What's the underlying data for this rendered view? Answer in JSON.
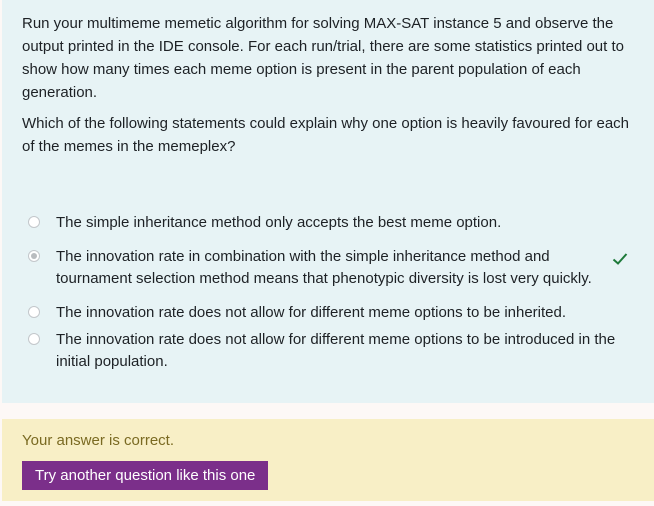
{
  "question": {
    "paragraph1": "Run your multimeme memetic algorithm for solving MAX-SAT instance 5 and observe the output printed in the IDE console. For each run/trial, there are some statistics printed out to show how many times each meme option is present in the parent population of each generation.",
    "paragraph2": "Which of the following statements could explain why one option is heavily favoured for each of the memes in the memeplex?"
  },
  "answers": [
    {
      "label": "The simple inheritance method only accepts the best meme option.",
      "selected": false,
      "correct": false
    },
    {
      "label": "The innovation rate in combination with the simple inheritance method and tournament selection method means that phenotypic diversity is lost very quickly.",
      "selected": true,
      "correct": true
    },
    {
      "label": "The innovation rate does not allow for different meme options to be inherited.",
      "selected": false,
      "correct": false
    },
    {
      "label": "The innovation rate does not allow for different meme options to be introduced in the initial population.",
      "selected": false,
      "correct": false
    }
  ],
  "feedback": {
    "text": "Your answer is correct.",
    "button_label": "Try another question like this one"
  },
  "colors": {
    "question_bg": "#e7f3f5",
    "feedback_bg": "#f8efc6",
    "button_bg": "#7b2f8a",
    "check": "#1e7a3a"
  }
}
